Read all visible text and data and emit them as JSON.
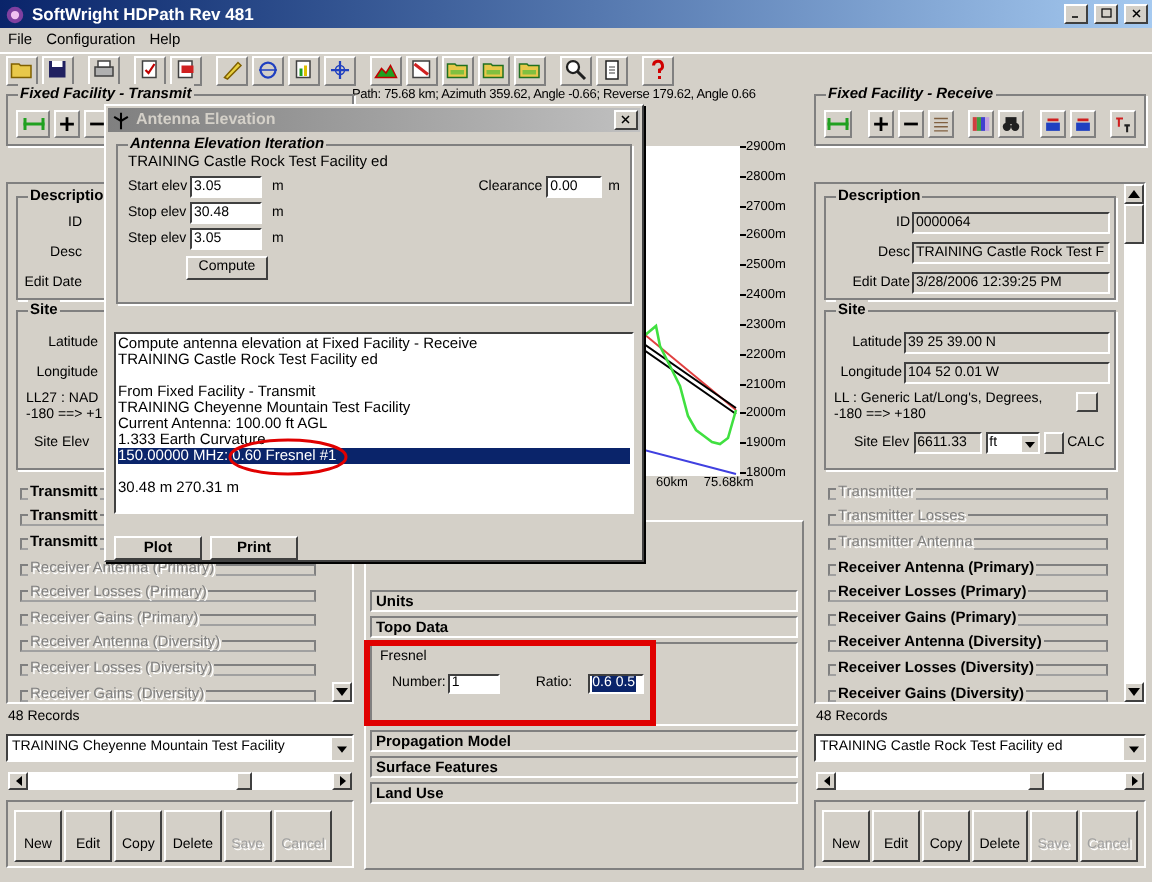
{
  "window": {
    "title": "SoftWright HDPath Rev 481"
  },
  "menu": [
    "File",
    "Configuration",
    "Help"
  ],
  "path_info": "Path: 75.68 km; Azimuth 359.62, Angle -0.66; Reverse 179.62, Angle 0.66",
  "transmit_panel": {
    "title": "Fixed Facility - Transmit",
    "description": {
      "title": "Descriptio",
      "fields": [
        {
          "label": "ID"
        },
        {
          "label": "Desc"
        },
        {
          "label": "Edit Date"
        }
      ]
    },
    "site": {
      "title": "Site",
      "fields": [
        {
          "label": "Latitude"
        },
        {
          "label": "Longitude"
        }
      ],
      "datum": [
        "LL27 : NAD",
        "-180 ==> +1"
      ],
      "elev_label": "Site Elev"
    },
    "sections": [
      {
        "label": "Transmitt",
        "enabled": true
      },
      {
        "label": "Transmitt",
        "enabled": true
      },
      {
        "label": "Transmitt",
        "enabled": true
      },
      {
        "label": "Receiver Antenna (Primary)",
        "enabled": false
      },
      {
        "label": "Receiver Losses (Primary)",
        "enabled": false
      },
      {
        "label": "Receiver Gains (Primary)",
        "enabled": false
      },
      {
        "label": "Receiver Antenna (Diversity)",
        "enabled": false
      },
      {
        "label": "Receiver Losses (Diversity)",
        "enabled": false
      },
      {
        "label": "Receiver Gains (Diversity)",
        "enabled": false
      }
    ],
    "record_count": "48 Records",
    "facility": "TRAINING Cheyenne Mountain Test Facility",
    "buttons": [
      {
        "label": "New",
        "disabled": false
      },
      {
        "label": "Edit",
        "disabled": false
      },
      {
        "label": "Copy",
        "disabled": false
      },
      {
        "label": "Delete",
        "disabled": false
      },
      {
        "label": "Save",
        "disabled": true
      },
      {
        "label": "Cancel",
        "disabled": true
      }
    ]
  },
  "receive_panel": {
    "title": "Fixed Facility - Receive",
    "description": {
      "title": "Description",
      "fields": [
        {
          "label": "ID",
          "value": "0000064"
        },
        {
          "label": "Desc",
          "value": "TRAINING Castle Rock Test F"
        },
        {
          "label": "Edit Date",
          "value": "3/28/2006 12:39:25 PM"
        }
      ]
    },
    "site": {
      "title": "Site",
      "fields": [
        {
          "label": "Latitude",
          "value": "39 25 39.00 N"
        },
        {
          "label": "Longitude",
          "value": "104 52 0.01 W"
        }
      ],
      "datum": [
        "LL : Generic Lat/Long's, Degrees,",
        "-180 ==> +180"
      ],
      "elev_label": "Site Elev",
      "elev_value": "6611.33",
      "elev_unit": "ft",
      "calc": "CALC"
    },
    "sections": [
      {
        "label": "Transmitter",
        "enabled": false
      },
      {
        "label": "Transmitter Losses",
        "enabled": false
      },
      {
        "label": "Transmitter Antenna",
        "enabled": false
      },
      {
        "label": "Receiver Antenna (Primary)",
        "enabled": true
      },
      {
        "label": "Receiver Losses (Primary)",
        "enabled": true
      },
      {
        "label": "Receiver Gains (Primary)",
        "enabled": true
      },
      {
        "label": "Receiver Antenna (Diversity)",
        "enabled": true
      },
      {
        "label": "Receiver Losses (Diversity)",
        "enabled": true
      },
      {
        "label": "Receiver Gains (Diversity)",
        "enabled": true
      }
    ],
    "record_count": "48 Records",
    "facility": "TRAINING Castle Rock Test Facility ed",
    "buttons": [
      {
        "label": "New",
        "disabled": false
      },
      {
        "label": "Edit",
        "disabled": false
      },
      {
        "label": "Copy",
        "disabled": false
      },
      {
        "label": "Delete",
        "disabled": false
      },
      {
        "label": "Save",
        "disabled": true
      },
      {
        "label": "Cancel",
        "disabled": true
      }
    ]
  },
  "profile": {
    "y_labels": [
      "2900m",
      "2800m",
      "2700m",
      "2600m",
      "2500m",
      "2400m",
      "2300m",
      "2200m",
      "2100m",
      "2000m",
      "1900m",
      "1800m"
    ],
    "x_labels": [
      "60km",
      "75.68km"
    ]
  },
  "settings": [
    {
      "kind": "heading",
      "label": "Units"
    },
    {
      "kind": "heading",
      "label": "Topo Data"
    },
    {
      "kind": "fresnel",
      "label": "Fresnel",
      "number_label": "Number:",
      "number": "1",
      "ratio_label": "Ratio:",
      "ratio": "0.6 0.5",
      "ratio_selected": true
    },
    {
      "kind": "heading",
      "label": "Propagation Model"
    },
    {
      "kind": "heading",
      "label": "Surface Features"
    },
    {
      "kind": "heading",
      "label": "Land Use"
    }
  ],
  "dialog": {
    "title": "Antenna Elevation",
    "group": "Antenna Elevation Iteration",
    "facility": "TRAINING Castle Rock Test Facility ed",
    "fields": [
      {
        "label": "Start elev",
        "value": "3.05",
        "unit": "m"
      },
      {
        "label": "Stop elev",
        "value": "30.48",
        "unit": "m"
      },
      {
        "label": "Step elev",
        "value": "3.05",
        "unit": "m"
      }
    ],
    "clearance": {
      "label": "Clearance",
      "value": "0.00",
      "unit": "m"
    },
    "compute": "Compute",
    "results": [
      [
        {
          "text": "Compute antenna elevation at Fixed Facility - Receive",
          "selected": false
        },
        {
          "text": "TRAINING Castle Rock Test Facility ed",
          "selected": false
        }
      ],
      [
        {
          "text": "From Fixed Facility - Transmit",
          "selected": false
        },
        {
          "text": "TRAINING Cheyenne Mountain Test Facility",
          "selected": false
        },
        {
          "text": "Current Antenna: 100.00 ft AGL",
          "selected": false
        },
        {
          "text": "1.333 Earth Curvature",
          "selected": false
        },
        {
          "text": "150.00000 MHz: 0.60 Fresnel #1",
          "selected": true
        }
      ],
      [
        {
          "text": "30.48 m 270.31 m",
          "selected": false
        }
      ]
    ],
    "buttons": [
      "Plot",
      "Print"
    ]
  }
}
